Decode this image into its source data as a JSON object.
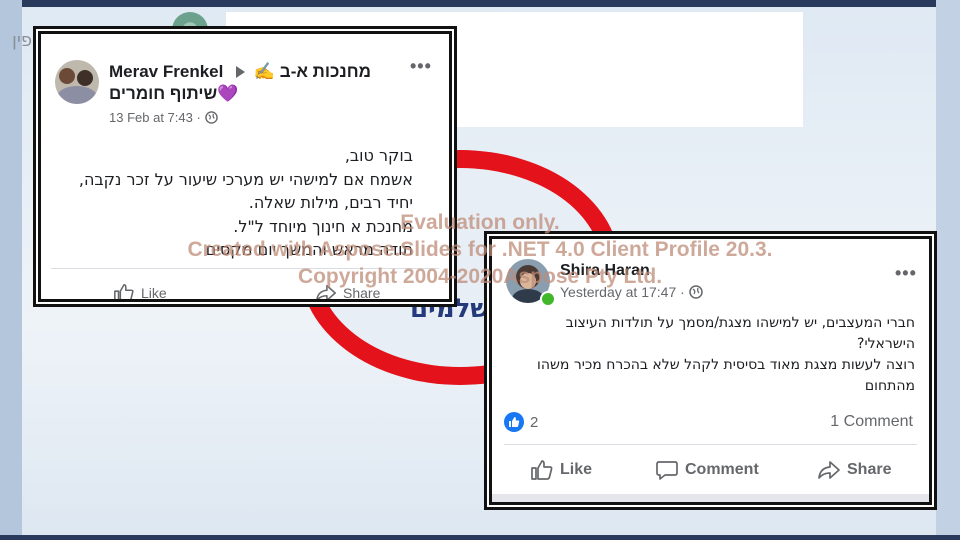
{
  "background": {
    "corner_text": "פין",
    "circle_text": "שלמים"
  },
  "post1": {
    "author": "Merav Frenkel",
    "group_line1": "מחנכות א-ב ✍",
    "group_line2": "שיתוף חומרים💜",
    "timestamp": "13 Feb at 7:43 ·",
    "body": [
      "בוקר טוב,",
      "אשמח אם למישהי יש מערכי שיעור על זכר נקבה,",
      "יחיד רבים, מילות שאלה.",
      "מחנכת א חינוך מיוחד ל\"ל.",
      "תודה מראש והמשך יום מקסים"
    ],
    "like_label": "Like",
    "share_label": "Share"
  },
  "post2": {
    "author": "Shira Haran",
    "timestamp": "Yesterday at 17:47 ·",
    "body": [
      "חברי המעצבים, יש למישהו מצגת/מסמך על תולדות העיצוב",
      "הישראלי?",
      "רוצה לעשות מצגת מאוד בסיסית לקהל שלא בהכרח מכיר משהו",
      "מהתחום"
    ],
    "reactions_count": "2",
    "comments_count": "1 Comment",
    "like_label": "Like",
    "comment_label": "Comment",
    "share_label": "Share"
  },
  "watermark": {
    "line1": "Evaluation only.",
    "line2": "Created with Aspose.Slides for .NET 4.0 Client Profile 20.3.",
    "line3": "Copyright 2004-2020Aspose Pty Ltd."
  },
  "colors": {
    "frame": "#2a3a5c",
    "ring": "#e3121b",
    "link_blue": "#1877f2",
    "online_green": "#42b72a"
  }
}
